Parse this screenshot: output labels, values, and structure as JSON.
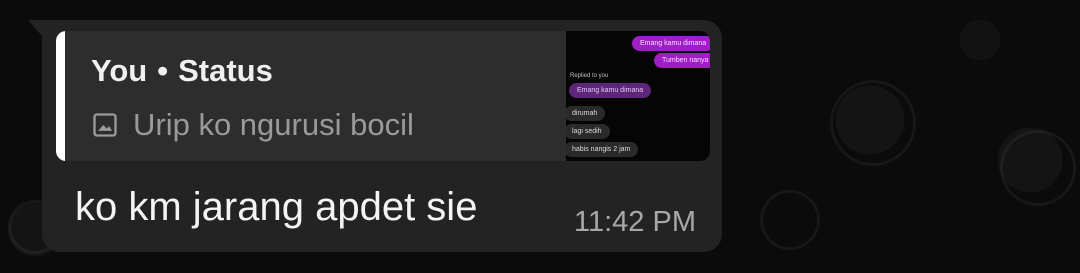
{
  "message": {
    "quote": {
      "author": "You",
      "separator": "•",
      "source": "Status",
      "icon": "image-icon",
      "preview_text": "Urip ko ngurusi bocil",
      "thumbnail": {
        "messages": [
          {
            "text": "Emang kamu dimana",
            "style": "purple"
          },
          {
            "text": "Tumben nanya",
            "style": "purple"
          },
          {
            "text": "Replied to you",
            "style": "label"
          },
          {
            "text": "Emang kamu dimana",
            "style": "purple-dark"
          },
          {
            "text": "dirumah",
            "style": "gray"
          },
          {
            "text": "lagi sedih",
            "style": "gray"
          },
          {
            "text": "habis nangis 2 jam",
            "style": "gray"
          }
        ]
      }
    },
    "text": "ko km jarang apdet sie",
    "time": "11:42 PM"
  },
  "colors": {
    "bubble": "#232323",
    "quote_card": "#2d2d2d",
    "accent": "#ffffff",
    "text": "#f4f4f4",
    "muted": "#9a9a9a",
    "timestamp": "#a8a8a8",
    "thumb_purple": "#a01ec5"
  }
}
